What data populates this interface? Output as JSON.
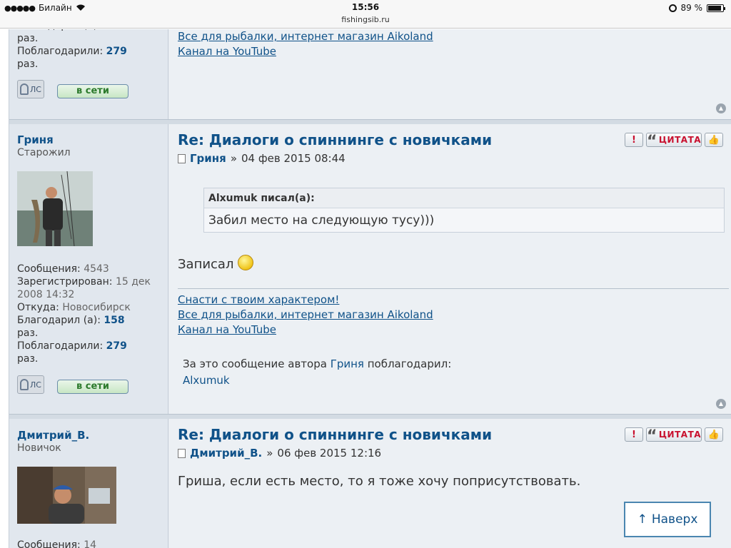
{
  "status_bar": {
    "signal": "●●●●●",
    "carrier": "Билайн",
    "wifi_icon": "wifi-icon",
    "time": "15:56",
    "url": "fishingsib.ru",
    "battery_percent": "89 %",
    "battery_level": 0.89
  },
  "posts": [
    {
      "partial": true,
      "author": {
        "stats_thanked_suffix": "раз.",
        "thanked_by_label": "Поблагодарили:",
        "thanked_by": "279",
        "thanked_by_suffix": "раз."
      },
      "buttons": {
        "pm": "ЛС",
        "online": "в сети"
      },
      "signature": [
        "Все для рыбалки, интернет магазин Aikoland",
        "Канал на YouTube"
      ]
    },
    {
      "author": {
        "name": "Гриня",
        "rank": "Старожил",
        "messages_label": "Сообщения:",
        "messages": "4543",
        "registered_label": "Зарегистрирован:",
        "registered": "15 дек 2008 14:32",
        "from_label": "Откуда:",
        "from": "Новосибирск",
        "thanked_label": "Благодарил (а):",
        "thanked": "158",
        "thanked_suffix": "раз.",
        "thanked_by_label": "Поблагодарили:",
        "thanked_by": "279",
        "thanked_by_suffix": "раз."
      },
      "buttons": {
        "pm": "ЛС",
        "online": "в сети",
        "report": "!",
        "quote": "ЦИТАТА"
      },
      "title": "Re: Диалоги о спиннинге с новичками",
      "meta_sep": "»",
      "date": "04 фев 2015 08:44",
      "quote": {
        "header": "Alxumuk писал(а):",
        "text": "Забил место на следующую тусу)))"
      },
      "text": "Записал",
      "signature": [
        "Снасти с твоим характером!",
        "Все для рыбалки, интернет магазин Aikoland",
        "Канал на YouTube"
      ],
      "thanks": {
        "prefix": "За это сообщение автора",
        "author": "Гриня",
        "suffix": "поблагодарил:",
        "users": "Alxumuk"
      }
    },
    {
      "author": {
        "name": "Дмитрий_В.",
        "rank": "Новичок",
        "messages_label": "Сообщения:",
        "messages": "14"
      },
      "buttons": {
        "report": "!",
        "quote": "ЦИТАТА"
      },
      "title": "Re: Диалоги о спиннинге с новичками",
      "meta_sep": "»",
      "date": "06 фев 2015 12:16",
      "text": "Гриша, если есть место, то я тоже хочу поприсутствовать."
    }
  ],
  "back_to_top": {
    "arrow": "↑",
    "label": "Наверх"
  },
  "colors": {
    "link": "#105289",
    "quote_red": "#c8102e",
    "online_green": "#2c7a2c"
  }
}
